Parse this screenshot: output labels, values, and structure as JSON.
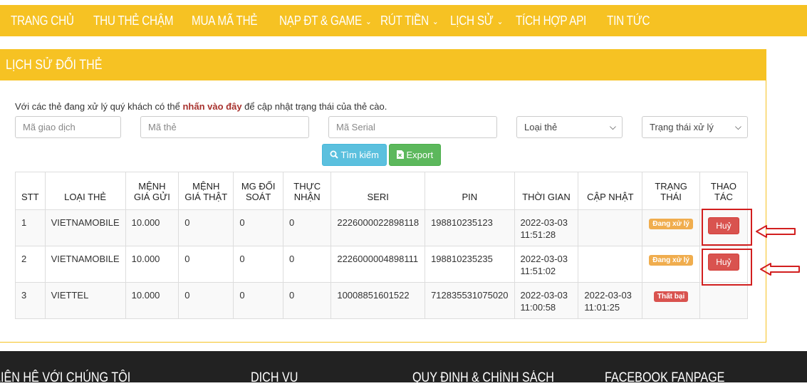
{
  "nav": {
    "items": [
      {
        "label": "TRANG CHỦ",
        "dropdown": false
      },
      {
        "label": "THU THẺ CHẬM",
        "dropdown": false
      },
      {
        "label": "MUA MÃ THẺ",
        "dropdown": false
      },
      {
        "label": "NẠP ĐT & GAME",
        "dropdown": true
      },
      {
        "label": "RÚT TIỀN",
        "dropdown": true
      },
      {
        "label": "LỊCH SỬ",
        "dropdown": true
      },
      {
        "label": "TÍCH HỢP API",
        "dropdown": false
      },
      {
        "label": "TIN TỨC",
        "dropdown": false
      }
    ]
  },
  "panel": {
    "title": "LỊCH SỬ ĐỔI THẺ",
    "notice_prefix": "Với các thẻ đang xử lý quý khách có thể ",
    "notice_link": "nhấn vào đây",
    "notice_suffix": " để cập nhật trạng thái của thẻ cào."
  },
  "filters": {
    "transaction_placeholder": "Mã giao dịch",
    "card_code_placeholder": "Mã thẻ",
    "serial_placeholder": "Mã Serial",
    "card_type_selected": "Loại thẻ",
    "status_selected": "Trạng thái xử lý",
    "search_label": "Tìm kiếm",
    "export_label": "Export"
  },
  "table": {
    "headers": [
      "STT",
      "LOẠI THẺ",
      "MỆNH GIÁ GỬI",
      "MỆNH GIÁ THẬT",
      "MG ĐỐI SOÁT",
      "THỰC NHẬN",
      "SERI",
      "PIN",
      "THỜI GIAN",
      "CẬP NHẬT",
      "TRẠNG THÁI",
      "THAO TÁC"
    ],
    "rows": [
      {
        "stt": "1",
        "type": "VIETNAMOBILE",
        "sent": "10.000",
        "real": "0",
        "reconcile": "0",
        "received": "0",
        "serial": "2226000022898118",
        "pin": "198810235123",
        "time": "2022-03-03 11:51:28",
        "updated": "",
        "status": "Đang xử lý",
        "action": "Huỷ"
      },
      {
        "stt": "2",
        "type": "VIETNAMOBILE",
        "sent": "10.000",
        "real": "0",
        "reconcile": "0",
        "received": "0",
        "serial": "2226000004898111",
        "pin": "198810235235",
        "time": "2022-03-03 11:51:02",
        "updated": "",
        "status": "Đang xử lý",
        "action": "Huỷ"
      },
      {
        "stt": "3",
        "type": "VIETTEL",
        "sent": "10.000",
        "real": "0",
        "reconcile": "0",
        "received": "0",
        "serial": "10008851601522",
        "pin": "712835531075020",
        "time": "2022-03-03 11:00:58",
        "updated": "2022-03-03 11:01:25",
        "status": "Thất bại",
        "action": ""
      }
    ]
  },
  "footer": {
    "contact": "LIÊN HỆ VỚI CHÚNG TÔI",
    "services": "DỊCH VỤ",
    "policy": "QUY ĐỊNH & CHÍNH SÁCH",
    "fanpage": "FACEBOOK FANPAGE"
  },
  "colors": {
    "brand": "#f6c223",
    "danger": "#d9534f",
    "warning": "#f0ad4e",
    "info": "#5bc0de",
    "success": "#5cb85c",
    "footer": "#222222",
    "annotation": "#d21f1f"
  }
}
